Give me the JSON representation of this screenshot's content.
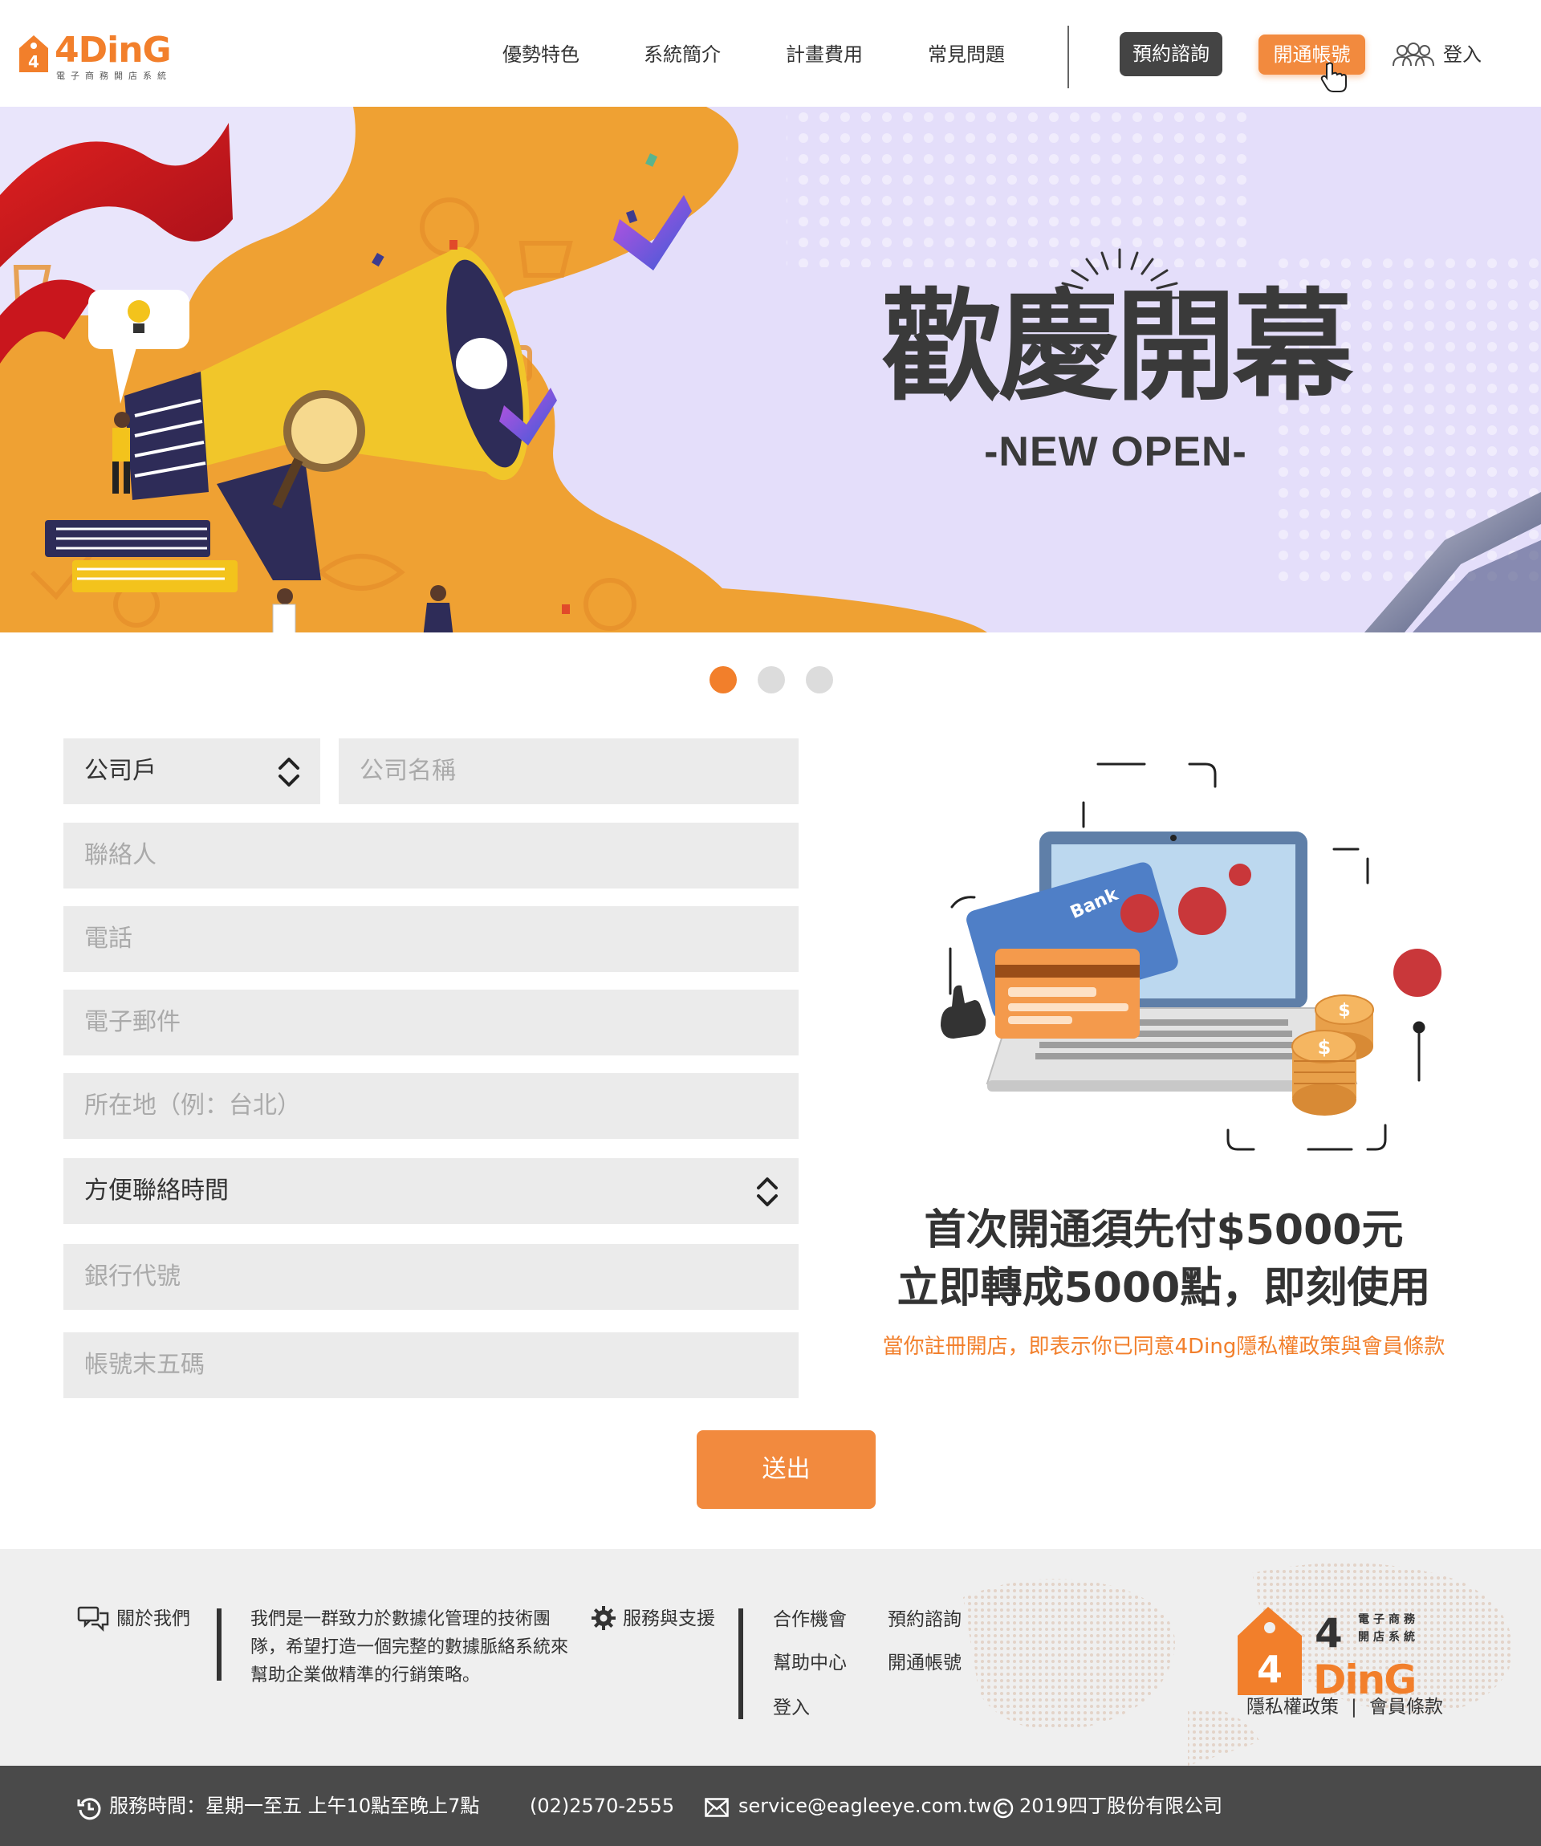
{
  "header": {
    "logo": {
      "brand": "4DinG",
      "subtitle": "電子商務開店系統"
    },
    "nav": [
      "優勢特色",
      "系統簡介",
      "計畫費用",
      "常見問題"
    ],
    "consult_button": "預約諮詢",
    "open_account_button": "開通帳號",
    "login_label": "登入"
  },
  "banner": {
    "title": "歡慶開幕",
    "subtitle": "-NEW OPEN-"
  },
  "carousel": {
    "count": 3,
    "active_index": 0
  },
  "form": {
    "account_type": "公司戶",
    "company_name_placeholder": "公司名稱",
    "contact_placeholder": "聯絡人",
    "phone_placeholder": "電話",
    "email_placeholder": "電子郵件",
    "location_placeholder": "所在地（例：台北）",
    "contact_time": "方便聯絡時間",
    "bank_code_placeholder": "銀行代號",
    "account_last5_placeholder": "帳號末五碼",
    "submit_label": "送出"
  },
  "promo": {
    "line1": "首次開通須先付$5000元",
    "line2": "立即轉成5000點，即刻使用",
    "note": "當你註冊開店，即表示你已同意4Ding隱私權政策與會員條款",
    "card_label": "Bank"
  },
  "footer": {
    "about_title": "關於我們",
    "about_text": "我們是一群致力於數據化管理的技術團隊，希望打造一個完整的數據脈絡系統來幫助企業做精準的行銷策略。",
    "support_title": "服務與支援",
    "links": [
      "合作機會",
      "預約諮詢",
      "幫助中心",
      "開通帳號",
      "登入"
    ],
    "privacy_label": "隱私權政策",
    "separator": "|",
    "terms_label": "會員條款",
    "logo_brand": "DinG",
    "logo_digit": "4",
    "logo_sub_1": "電子商務",
    "logo_sub_2": "開店系統"
  },
  "bottom_bar": {
    "hours": "服務時間：星期一至五 上午10點至晚上7點",
    "phone": "(02)2570-2555",
    "email": "service@eagleeye.com.tw",
    "copyright": "2019四丁股份有限公司"
  },
  "colors": {
    "accent": "#f27f2b",
    "dark": "#444444",
    "banner_bg": "#e4defa",
    "field_bg": "#ebebeb"
  }
}
